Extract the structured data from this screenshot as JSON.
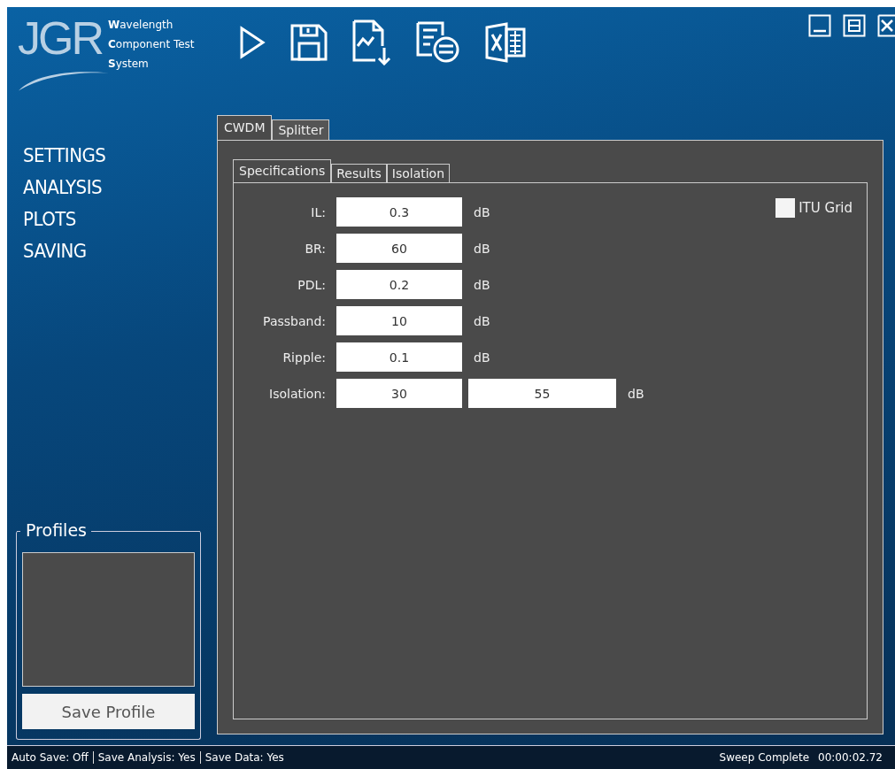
{
  "logo": {
    "mark": "JGR",
    "lines": [
      "**W**avelength",
      "**C**omponent Test",
      "**S**ystem"
    ]
  },
  "toolbar": [
    {
      "kind": "play"
    },
    {
      "kind": "save"
    },
    {
      "kind": "export"
    },
    {
      "kind": "report"
    },
    {
      "kind": "excel"
    }
  ],
  "window_controls": [
    {
      "kind": "minimize"
    },
    {
      "kind": "restore"
    },
    {
      "kind": "close"
    }
  ],
  "nav": [
    {
      "label": "SETTINGS"
    },
    {
      "label": "ANALYSIS"
    },
    {
      "label": "PLOTS"
    },
    {
      "label": "SAVING"
    }
  ],
  "profiles": {
    "title": "Profiles",
    "button": "Save Profile"
  },
  "tabs": [
    {
      "label": "CWDM",
      "selected": true
    },
    {
      "label": "Splitter",
      "selected": false
    }
  ],
  "subtabs": [
    {
      "label": "Specifications",
      "selected": true
    },
    {
      "label": "Results",
      "selected": false
    },
    {
      "label": "Isolation",
      "selected": false
    }
  ],
  "fields": [
    {
      "label": "IL:",
      "values": [
        "0.3"
      ],
      "unit": "dB"
    },
    {
      "label": "BR:",
      "values": [
        "60"
      ],
      "unit": "dB"
    },
    {
      "label": "PDL:",
      "values": [
        "0.2"
      ],
      "unit": "dB"
    },
    {
      "label": "Passband:",
      "values": [
        "10"
      ],
      "unit": "dB"
    },
    {
      "label": "Ripple:",
      "values": [
        "0.1"
      ],
      "unit": "dB"
    },
    {
      "label": "Isolation:",
      "values": [
        "30",
        "55"
      ],
      "unit": "dB"
    }
  ],
  "itu_grid": {
    "label": "ITU Grid",
    "checked": false
  },
  "status_bar": {
    "items": [
      "Auto Save: Off",
      "Save Analysis: Yes",
      "Save Data: Yes"
    ],
    "status": "Sweep Complete",
    "time": "00:00:02.72"
  }
}
